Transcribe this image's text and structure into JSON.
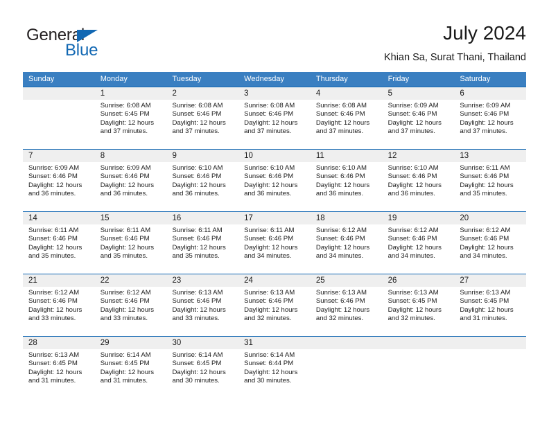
{
  "brand": {
    "name_part1": "General",
    "name_part2": "Blue"
  },
  "header": {
    "title": "July 2024",
    "subtitle": "Khian Sa, Surat Thani, Thailand"
  },
  "colors": {
    "header_blue": "#3a7fc1",
    "rule_blue": "#1268b3",
    "band_gray": "#efefef",
    "text": "#1a1a1a"
  },
  "daynames": [
    "Sunday",
    "Monday",
    "Tuesday",
    "Wednesday",
    "Thursday",
    "Friday",
    "Saturday"
  ],
  "weeks": [
    {
      "cells": [
        {
          "day": "",
          "info": ""
        },
        {
          "day": "1",
          "info": "Sunrise: 6:08 AM\nSunset: 6:45 PM\nDaylight: 12 hours\nand 37 minutes."
        },
        {
          "day": "2",
          "info": "Sunrise: 6:08 AM\nSunset: 6:46 PM\nDaylight: 12 hours\nand 37 minutes."
        },
        {
          "day": "3",
          "info": "Sunrise: 6:08 AM\nSunset: 6:46 PM\nDaylight: 12 hours\nand 37 minutes."
        },
        {
          "day": "4",
          "info": "Sunrise: 6:08 AM\nSunset: 6:46 PM\nDaylight: 12 hours\nand 37 minutes."
        },
        {
          "day": "5",
          "info": "Sunrise: 6:09 AM\nSunset: 6:46 PM\nDaylight: 12 hours\nand 37 minutes."
        },
        {
          "day": "6",
          "info": "Sunrise: 6:09 AM\nSunset: 6:46 PM\nDaylight: 12 hours\nand 37 minutes."
        }
      ]
    },
    {
      "cells": [
        {
          "day": "7",
          "info": "Sunrise: 6:09 AM\nSunset: 6:46 PM\nDaylight: 12 hours\nand 36 minutes."
        },
        {
          "day": "8",
          "info": "Sunrise: 6:09 AM\nSunset: 6:46 PM\nDaylight: 12 hours\nand 36 minutes."
        },
        {
          "day": "9",
          "info": "Sunrise: 6:10 AM\nSunset: 6:46 PM\nDaylight: 12 hours\nand 36 minutes."
        },
        {
          "day": "10",
          "info": "Sunrise: 6:10 AM\nSunset: 6:46 PM\nDaylight: 12 hours\nand 36 minutes."
        },
        {
          "day": "11",
          "info": "Sunrise: 6:10 AM\nSunset: 6:46 PM\nDaylight: 12 hours\nand 36 minutes."
        },
        {
          "day": "12",
          "info": "Sunrise: 6:10 AM\nSunset: 6:46 PM\nDaylight: 12 hours\nand 36 minutes."
        },
        {
          "day": "13",
          "info": "Sunrise: 6:11 AM\nSunset: 6:46 PM\nDaylight: 12 hours\nand 35 minutes."
        }
      ]
    },
    {
      "cells": [
        {
          "day": "14",
          "info": "Sunrise: 6:11 AM\nSunset: 6:46 PM\nDaylight: 12 hours\nand 35 minutes."
        },
        {
          "day": "15",
          "info": "Sunrise: 6:11 AM\nSunset: 6:46 PM\nDaylight: 12 hours\nand 35 minutes."
        },
        {
          "day": "16",
          "info": "Sunrise: 6:11 AM\nSunset: 6:46 PM\nDaylight: 12 hours\nand 35 minutes."
        },
        {
          "day": "17",
          "info": "Sunrise: 6:11 AM\nSunset: 6:46 PM\nDaylight: 12 hours\nand 34 minutes."
        },
        {
          "day": "18",
          "info": "Sunrise: 6:12 AM\nSunset: 6:46 PM\nDaylight: 12 hours\nand 34 minutes."
        },
        {
          "day": "19",
          "info": "Sunrise: 6:12 AM\nSunset: 6:46 PM\nDaylight: 12 hours\nand 34 minutes."
        },
        {
          "day": "20",
          "info": "Sunrise: 6:12 AM\nSunset: 6:46 PM\nDaylight: 12 hours\nand 34 minutes."
        }
      ]
    },
    {
      "cells": [
        {
          "day": "21",
          "info": "Sunrise: 6:12 AM\nSunset: 6:46 PM\nDaylight: 12 hours\nand 33 minutes."
        },
        {
          "day": "22",
          "info": "Sunrise: 6:12 AM\nSunset: 6:46 PM\nDaylight: 12 hours\nand 33 minutes."
        },
        {
          "day": "23",
          "info": "Sunrise: 6:13 AM\nSunset: 6:46 PM\nDaylight: 12 hours\nand 33 minutes."
        },
        {
          "day": "24",
          "info": "Sunrise: 6:13 AM\nSunset: 6:46 PM\nDaylight: 12 hours\nand 32 minutes."
        },
        {
          "day": "25",
          "info": "Sunrise: 6:13 AM\nSunset: 6:46 PM\nDaylight: 12 hours\nand 32 minutes."
        },
        {
          "day": "26",
          "info": "Sunrise: 6:13 AM\nSunset: 6:45 PM\nDaylight: 12 hours\nand 32 minutes."
        },
        {
          "day": "27",
          "info": "Sunrise: 6:13 AM\nSunset: 6:45 PM\nDaylight: 12 hours\nand 31 minutes."
        }
      ]
    },
    {
      "cells": [
        {
          "day": "28",
          "info": "Sunrise: 6:13 AM\nSunset: 6:45 PM\nDaylight: 12 hours\nand 31 minutes."
        },
        {
          "day": "29",
          "info": "Sunrise: 6:14 AM\nSunset: 6:45 PM\nDaylight: 12 hours\nand 31 minutes."
        },
        {
          "day": "30",
          "info": "Sunrise: 6:14 AM\nSunset: 6:45 PM\nDaylight: 12 hours\nand 30 minutes."
        },
        {
          "day": "31",
          "info": "Sunrise: 6:14 AM\nSunset: 6:44 PM\nDaylight: 12 hours\nand 30 minutes."
        },
        {
          "day": "",
          "info": ""
        },
        {
          "day": "",
          "info": ""
        },
        {
          "day": "",
          "info": ""
        }
      ]
    }
  ]
}
